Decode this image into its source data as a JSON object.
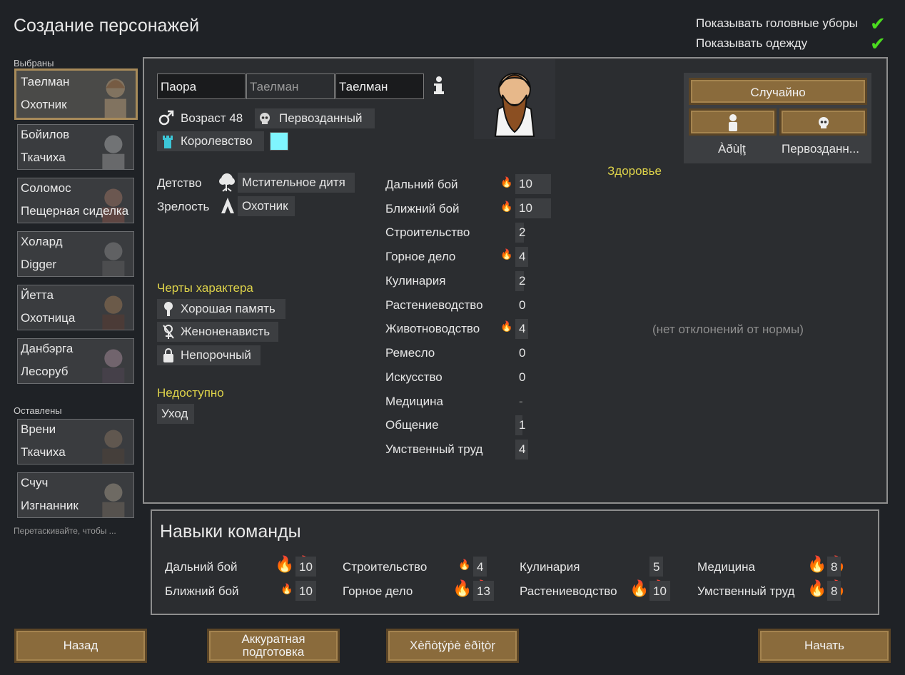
{
  "header": {
    "title": "Создание персонажей",
    "show_headgear": "Показывать головные уборы",
    "show_apparel": "Показывать одежду"
  },
  "sidebar": {
    "chosen_label": "Выбраны",
    "left_label": "Оставлены",
    "drag_hint": "Перетаскивайте, чтобы ...",
    "chosen": [
      {
        "name": "Таелман",
        "role": "Охотник"
      },
      {
        "name": "Бойилов",
        "role": "Ткачиха"
      },
      {
        "name": "Соломос",
        "role": "Пещерная сиделка"
      },
      {
        "name": "Холард",
        "role": "Digger"
      },
      {
        "name": "Йетта",
        "role": "Охотница"
      },
      {
        "name": "Данбэрга",
        "role": "Лесоруб"
      }
    ],
    "left": [
      {
        "name": "Врени",
        "role": "Ткачиха"
      },
      {
        "name": "Счуч",
        "role": "Изгнанник"
      }
    ]
  },
  "pawn": {
    "first_name": "Паора",
    "nick_placeholder": "Таелман",
    "last_name": "Таелман",
    "age": "Возраст 48",
    "xenotype": "Первозданный",
    "faction": "Королевство",
    "favorite_color": "#7ff5ff"
  },
  "backstory": {
    "childhood_label": "Детство",
    "childhood": "Мстительное дитя",
    "adulthood_label": "Зрелость",
    "adulthood": "Охотник"
  },
  "traits": {
    "label": "Черты характера",
    "items": [
      "Хорошая память",
      "Женоненависть",
      "Непорочный"
    ]
  },
  "incapable": {
    "label": "Недоступно",
    "items": [
      "Уход"
    ]
  },
  "skills": [
    {
      "name": "Дальний бой",
      "value": "10",
      "passion": 1
    },
    {
      "name": "Ближний бой",
      "value": "10",
      "passion": 1
    },
    {
      "name": "Строительство",
      "value": "2",
      "passion": 0
    },
    {
      "name": "Горное дело",
      "value": "4",
      "passion": 1
    },
    {
      "name": "Кулинария",
      "value": "2",
      "passion": 0
    },
    {
      "name": "Растениеводство",
      "value": "0",
      "passion": 0
    },
    {
      "name": "Животноводство",
      "value": "4",
      "passion": 1
    },
    {
      "name": "Ремесло",
      "value": "0",
      "passion": 0
    },
    {
      "name": "Искусство",
      "value": "0",
      "passion": 0
    },
    {
      "name": "Медицина",
      "value": "-",
      "passion": 0
    },
    {
      "name": "Общение",
      "value": "1",
      "passion": 0
    },
    {
      "name": "Умственный труд",
      "value": "4",
      "passion": 0
    }
  ],
  "health": {
    "label": "Здоровье",
    "empty": "(нет отклонений от нормы)"
  },
  "randomize": {
    "random_button": "Случайно",
    "adult_label": "Àðùļţ",
    "xeno_label": "Первозданн..."
  },
  "team": {
    "title": "Навыки команды",
    "skills": [
      {
        "name": "Дальний бой",
        "value": "10",
        "passion": 2
      },
      {
        "name": "Ближний бой",
        "value": "10",
        "passion": 1
      },
      {
        "name": "Строительство",
        "value": "4",
        "passion": 1
      },
      {
        "name": "Горное дело",
        "value": "13",
        "passion": 2
      },
      {
        "name": "Кулинария",
        "value": "5",
        "passion": 0
      },
      {
        "name": "Растениеводство",
        "value": "10",
        "passion": 2
      },
      {
        "name": "Медицина",
        "value": "8",
        "passion": 2
      },
      {
        "name": "Умственный труд",
        "value": "8",
        "passion": 2
      }
    ]
  },
  "footer": {
    "back": "Назад",
    "prep_line1": "Аккуратная",
    "prep_line2": "подготовка",
    "xeno_editor": "Xèñòţýṗè èðìţòŗ",
    "start": "Начать"
  },
  "colors": {
    "passion": "#f0a020",
    "check": "#4bdb1f",
    "header_yellow": "#ded34a",
    "button": "#8a6b3c"
  }
}
